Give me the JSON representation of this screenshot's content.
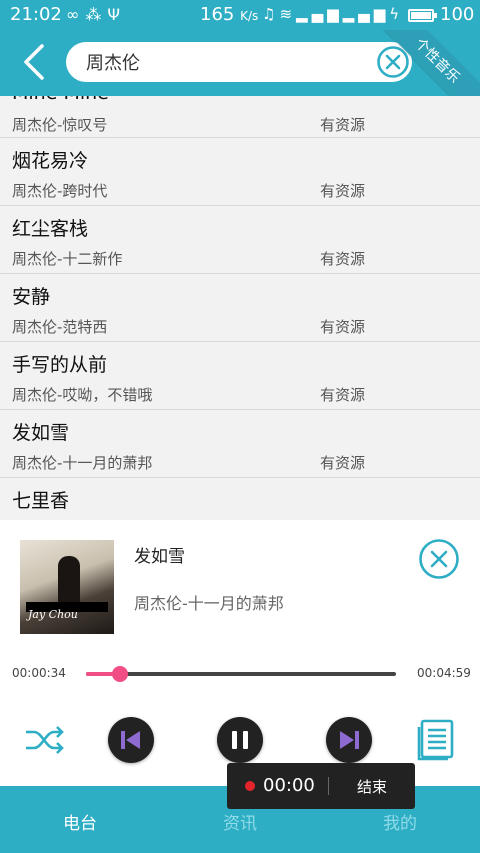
{
  "status_bar": {
    "time": "21:02",
    "speed": "165",
    "speed_unit": "K/s",
    "battery": "100"
  },
  "header": {
    "search": {
      "value": "周杰伦"
    },
    "ribbon_label": "个性音乐"
  },
  "results": [
    {
      "title": "Mine Mine",
      "artist": "周杰伦-惊叹号",
      "status": "有资源"
    },
    {
      "title": "烟花易冷",
      "artist": "周杰伦-跨时代",
      "status": "有资源"
    },
    {
      "title": "红尘客栈",
      "artist": "周杰伦-十二新作",
      "status": "有资源"
    },
    {
      "title": "安静",
      "artist": "周杰伦-范特西",
      "status": "有资源"
    },
    {
      "title": "手写的从前",
      "artist": "周杰伦-哎呦，不错哦",
      "status": "有资源"
    },
    {
      "title": "发如雪",
      "artist": "周杰伦-十一月的萧邦",
      "status": "有资源"
    },
    {
      "title": "七里香",
      "artist": "",
      "status": ""
    }
  ],
  "player": {
    "song_title": "发如雪",
    "song_subtitle": "周杰伦-十一月的萧邦",
    "album_logo": "Jay Chou",
    "current_time": "00:00:34",
    "total_time": "00:04:59",
    "progress": 0.11,
    "accent_color": "#f24e86"
  },
  "recording": {
    "timer": "00:00",
    "stop_label": "结束"
  },
  "tabs": [
    {
      "label": "电台",
      "active": true
    },
    {
      "label": "资讯",
      "active": false
    },
    {
      "label": "我的",
      "active": false
    }
  ],
  "colors": {
    "primary": "#2eaec5",
    "accent": "#f24e86"
  }
}
